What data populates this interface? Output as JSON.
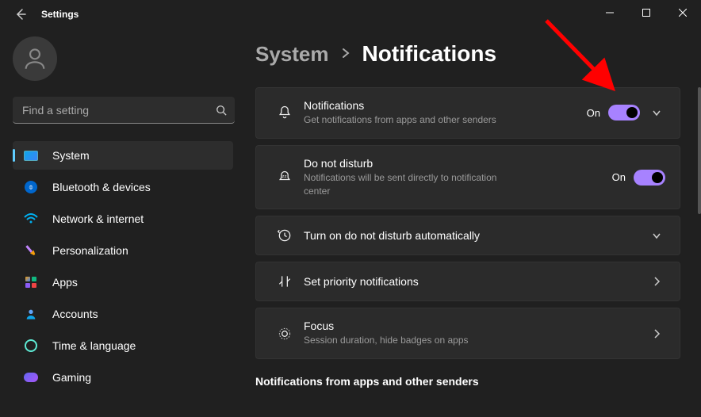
{
  "app_title": "Settings",
  "search": {
    "placeholder": "Find a setting"
  },
  "sidebar": {
    "items": [
      {
        "label": "System"
      },
      {
        "label": "Bluetooth & devices"
      },
      {
        "label": "Network & internet"
      },
      {
        "label": "Personalization"
      },
      {
        "label": "Apps"
      },
      {
        "label": "Accounts"
      },
      {
        "label": "Time & language"
      },
      {
        "label": "Gaming"
      }
    ]
  },
  "breadcrumb": {
    "parent": "System",
    "current": "Notifications"
  },
  "cards": {
    "notifications": {
      "title": "Notifications",
      "subtitle": "Get notifications from apps and other senders",
      "status": "On"
    },
    "dnd": {
      "title": "Do not disturb",
      "subtitle": "Notifications will be sent directly to notification center",
      "status": "On"
    },
    "auto_dnd": {
      "title": "Turn on do not disturb automatically"
    },
    "priority": {
      "title": "Set priority notifications"
    },
    "focus": {
      "title": "Focus",
      "subtitle": "Session duration, hide badges on apps"
    }
  },
  "section_title": "Notifications from apps and other senders",
  "colors": {
    "accent": "#a782ff"
  }
}
